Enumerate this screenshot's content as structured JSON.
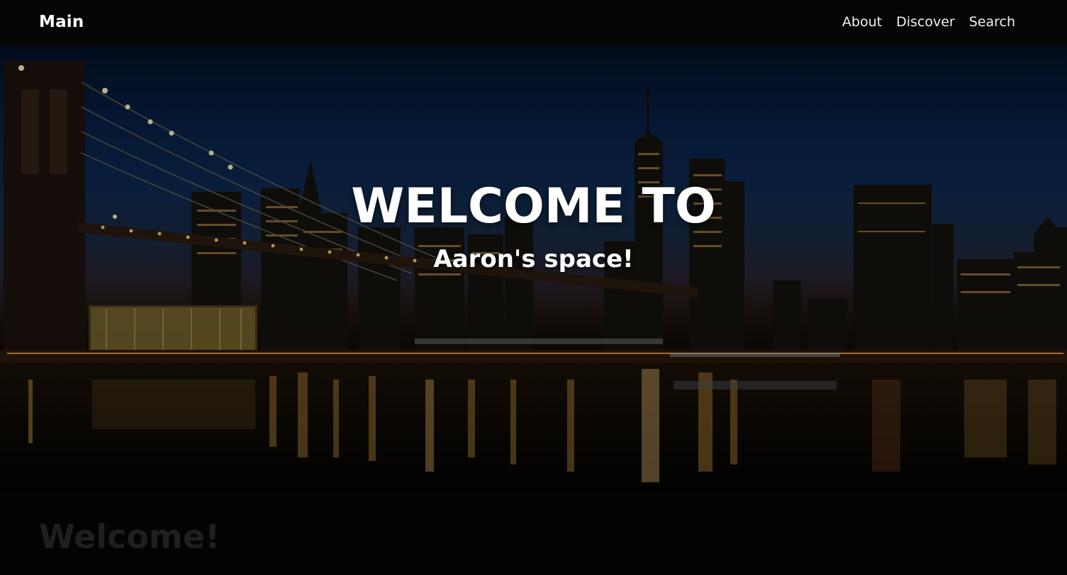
{
  "navbar": {
    "brand": "Main",
    "links": [
      "About",
      "Discover",
      "Search"
    ]
  },
  "hero": {
    "title": "WELCOME TO",
    "subtitle": "Aaron's space!"
  },
  "section": {
    "heading": "Welcome!"
  },
  "colors": {
    "navbar_bg": "#050505",
    "page_bg": "#030303",
    "heading_dim": "#1f1f22",
    "text": "#ffffff"
  }
}
